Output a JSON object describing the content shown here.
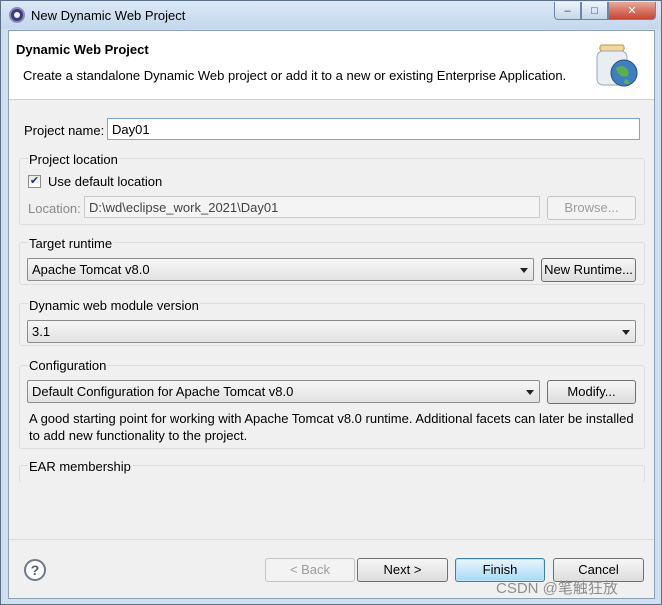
{
  "window": {
    "title": "New Dynamic Web Project",
    "controls": {
      "minimize": "–",
      "maximize": "□",
      "close": "✕"
    }
  },
  "banner": {
    "title": "Dynamic Web Project",
    "description": "Create a standalone Dynamic Web project or add it to a new or existing Enterprise Application.",
    "icon": "web-project-jar-globe-icon"
  },
  "project_name": {
    "label": "Project name:",
    "value": "Day01"
  },
  "project_location": {
    "group_label": "Project location",
    "use_default_label": "Use default location",
    "use_default_checked": true,
    "checkmark": "✔",
    "location_label": "Location:",
    "location_value": "D:\\wd\\eclipse_work_2021\\Day01",
    "browse_label": "Browse..."
  },
  "target_runtime": {
    "group_label": "Target runtime",
    "selected": "Apache Tomcat v8.0",
    "new_runtime_label": "New Runtime..."
  },
  "module_version": {
    "group_label": "Dynamic web module version",
    "selected": "3.1"
  },
  "configuration": {
    "group_label": "Configuration",
    "selected": "Default Configuration for Apache Tomcat v8.0",
    "modify_label": "Modify...",
    "description": "A good starting point for working with Apache Tomcat v8.0 runtime. Additional facets can later be installed to add new functionality to the project."
  },
  "ear": {
    "group_label": "EAR membership"
  },
  "footer": {
    "help_label": "?",
    "back_label": "< Back",
    "next_label": "Next >",
    "finish_label": "Finish",
    "cancel_label": "Cancel"
  },
  "watermark": "CSDN @笔触狂放",
  "colors": {
    "accent": "#3c7fb1",
    "titlebar": "#c4d7ec",
    "close_button": "#c7452f"
  }
}
